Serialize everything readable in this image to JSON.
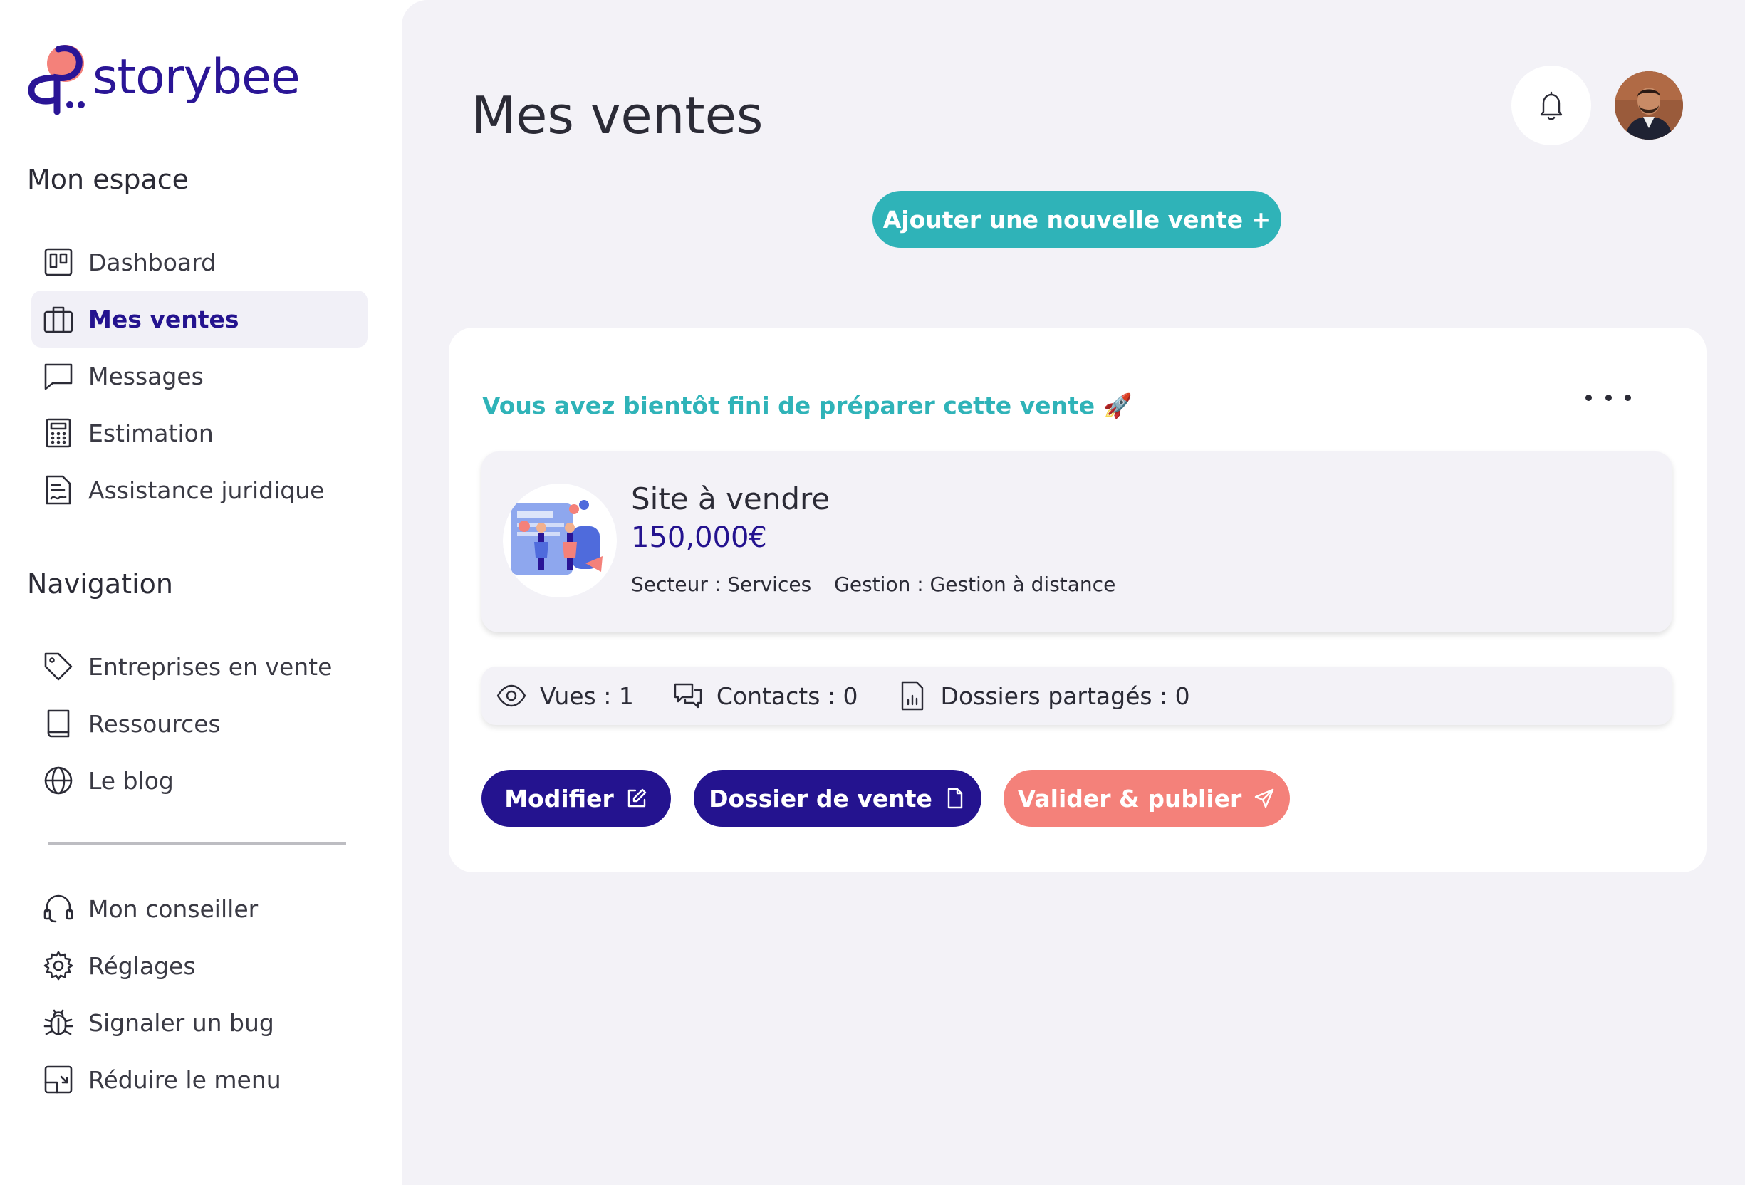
{
  "brand": {
    "name": "storybee",
    "color": "#2a1596",
    "accent": "#f4817a"
  },
  "sidebar": {
    "section1_title": "Mon espace",
    "section1_items": [
      {
        "label": "Dashboard",
        "icon": "dashboard-icon",
        "active": false
      },
      {
        "label": "Mes ventes",
        "icon": "briefcase-icon",
        "active": true
      },
      {
        "label": "Messages",
        "icon": "message-icon",
        "active": false
      },
      {
        "label": "Estimation",
        "icon": "calculator-icon",
        "active": false
      },
      {
        "label": "Assistance juridique",
        "icon": "document-signature-icon",
        "active": false
      }
    ],
    "section2_title": "Navigation",
    "section2_items": [
      {
        "label": "Entreprises en vente",
        "icon": "tag-icon"
      },
      {
        "label": "Ressources",
        "icon": "book-icon"
      },
      {
        "label": "Le blog",
        "icon": "globe-icon"
      }
    ],
    "section3_items": [
      {
        "label": "Mon conseiller",
        "icon": "headset-icon"
      },
      {
        "label": "Réglages",
        "icon": "gear-icon"
      },
      {
        "label": "Signaler un bug",
        "icon": "bug-icon"
      },
      {
        "label": "Réduire le menu",
        "icon": "collapse-menu-icon"
      }
    ]
  },
  "main": {
    "title": "Mes ventes",
    "add_button": "Ajouter une nouvelle vente +",
    "card": {
      "heading": "Vous avez bientôt fini de préparer cette vente 🚀",
      "sale": {
        "name": "Site à vendre",
        "price": "150,000€",
        "sector": "Secteur : Services",
        "management": "Gestion : Gestion à distance"
      },
      "stats": {
        "views": "Vues : 1",
        "contacts": "Contacts : 0",
        "shared": "Dossiers partagés : 0"
      },
      "buttons": {
        "edit": "Modifier",
        "dossier": "Dossier de vente",
        "publish": "Valider & publier"
      }
    }
  },
  "colors": {
    "primary": "#24138f",
    "teal": "#2fb3b8",
    "coral": "#f4817a",
    "background": "#f3f2f7"
  }
}
